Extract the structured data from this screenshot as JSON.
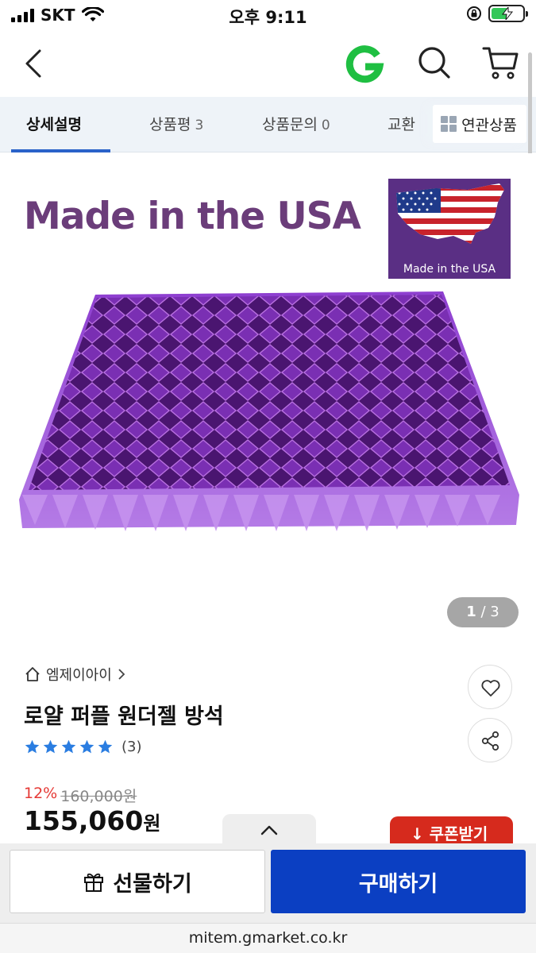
{
  "status_bar": {
    "carrier": "SKT",
    "time": "오후 9:11",
    "battery_level": 0.55
  },
  "header": {
    "back_icon": "chevron-left-icon",
    "logo_letter": "G",
    "search_icon": "search-icon",
    "cart_icon": "cart-icon"
  },
  "tabs": [
    {
      "label": "상세설명",
      "count": ""
    },
    {
      "label": "상품평",
      "count": "3"
    },
    {
      "label": "상품문의",
      "count": "0"
    },
    {
      "label": "교환",
      "count": ""
    }
  ],
  "related_button": {
    "label": "연관상품"
  },
  "product_image": {
    "headline": "Made in the USA",
    "flag_caption": "Made in the USA",
    "pager_current": "1",
    "pager_total": "3"
  },
  "product": {
    "seller": "엠제이아이",
    "title": "로얄 퍼플 원더젤 방석",
    "rating_stars": 5,
    "review_count": "(3)",
    "discount_rate": "12%",
    "original_price": "160,000원",
    "price": "155,060",
    "price_unit": "원"
  },
  "coupon_button": {
    "label": "↓ 쿠폰받기"
  },
  "bottom_bar": {
    "gift_label": "선물하기",
    "buy_label": "구매하기"
  },
  "url_bar": {
    "url": "mitem.gmarket.co.kr"
  },
  "colors": {
    "accent_blue": "#2a62c9",
    "buy_button": "#0b3fc2",
    "discount_red": "#e53935",
    "coupon_red": "#d62a1d",
    "star_blue": "#2a7de1",
    "cushion_purple": "#7a2fb3"
  }
}
